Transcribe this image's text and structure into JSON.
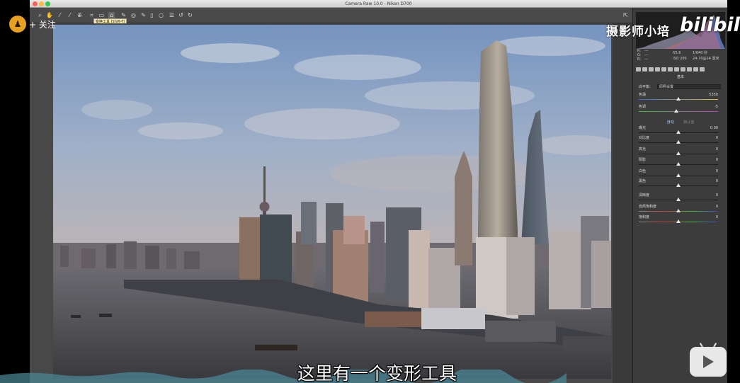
{
  "window": {
    "title": "Camera Raw 10.0 - Nikon D700"
  },
  "toolbar": {
    "tooltip": "变换工具 (Shift-T)",
    "tools": [
      "zoom-icon",
      "hand-icon",
      "white-balance-icon",
      "color-sampler-icon",
      "targeted-adjust-icon",
      "crop-icon",
      "straighten-icon",
      "transform-icon",
      "spot-removal-icon",
      "redeye-icon",
      "adjustment-brush-icon",
      "graduated-filter-icon",
      "radial-filter-icon",
      "preferences-icon",
      "rotate-ccw-icon",
      "rotate-cw-icon"
    ]
  },
  "overlay": {
    "follow_label": "+ 关注",
    "watermark": "摄影师小培",
    "site_logo": "bilibili",
    "subtitle": "这里有一个变形工具"
  },
  "panel": {
    "meta": {
      "r_label": "R:",
      "r_value": "---",
      "g_label": "G:",
      "g_value": "---",
      "b_label": "B:",
      "b_value": "---",
      "aperture": "f/5.6",
      "shutter": "1/640 秒",
      "iso": "ISO 200",
      "lens": "24-70@24 毫米"
    },
    "section_title": "基本",
    "wb_label": "白平衡:",
    "wb_value": "原照设置",
    "tone_auto": "自动",
    "tone_default": "默认值",
    "sliders": [
      {
        "label": "色温",
        "value": "5350",
        "level": 0.5
      },
      {
        "label": "色调",
        "value": "-5",
        "level": 0.47
      },
      {
        "label": "曝光",
        "value": "0.00",
        "level": 0.5
      },
      {
        "label": "对比度",
        "value": "0",
        "level": 0.5
      },
      {
        "label": "高光",
        "value": "0",
        "level": 0.5
      },
      {
        "label": "阴影",
        "value": "0",
        "level": 0.5
      },
      {
        "label": "白色",
        "value": "0",
        "level": 0.5
      },
      {
        "label": "黑色",
        "value": "0",
        "level": 0.5
      },
      {
        "label": "清晰度",
        "value": "0",
        "level": 0.5
      },
      {
        "label": "自然饱和度",
        "value": "0",
        "level": 0.5
      },
      {
        "label": "饱和度",
        "value": "0",
        "level": 0.5
      }
    ]
  },
  "colors": {
    "accent": "#e8a020",
    "panel": "#3c3c3c",
    "sky": "#7d9ac0"
  }
}
